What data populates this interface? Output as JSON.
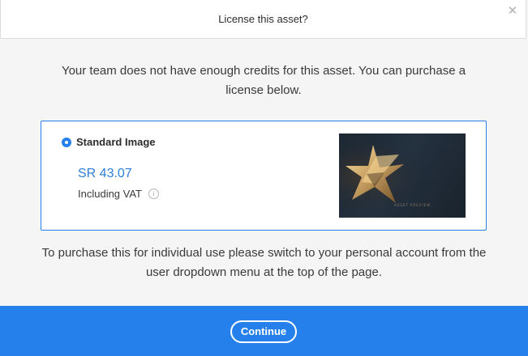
{
  "dialog": {
    "title": "License this asset?",
    "close_icon": "close-icon",
    "message": "Your team does not have enough credits for this asset. You can purchase a license below.",
    "option": {
      "label": "Standard Image",
      "selected": true,
      "price": "SR 43.07",
      "vat_label": "Including VAT",
      "info_icon": "info-icon",
      "thumbnail_caption": "ASSET PREVIEW"
    },
    "footer_message": "To purchase this for individual use please switch to your personal account from the user dropdown menu at the top of the page.",
    "continue_label": "Continue"
  },
  "colors": {
    "accent": "#2680eb",
    "price": "#2d7ed8",
    "background": "#f5f5f5",
    "header_bg": "#ffffff"
  }
}
